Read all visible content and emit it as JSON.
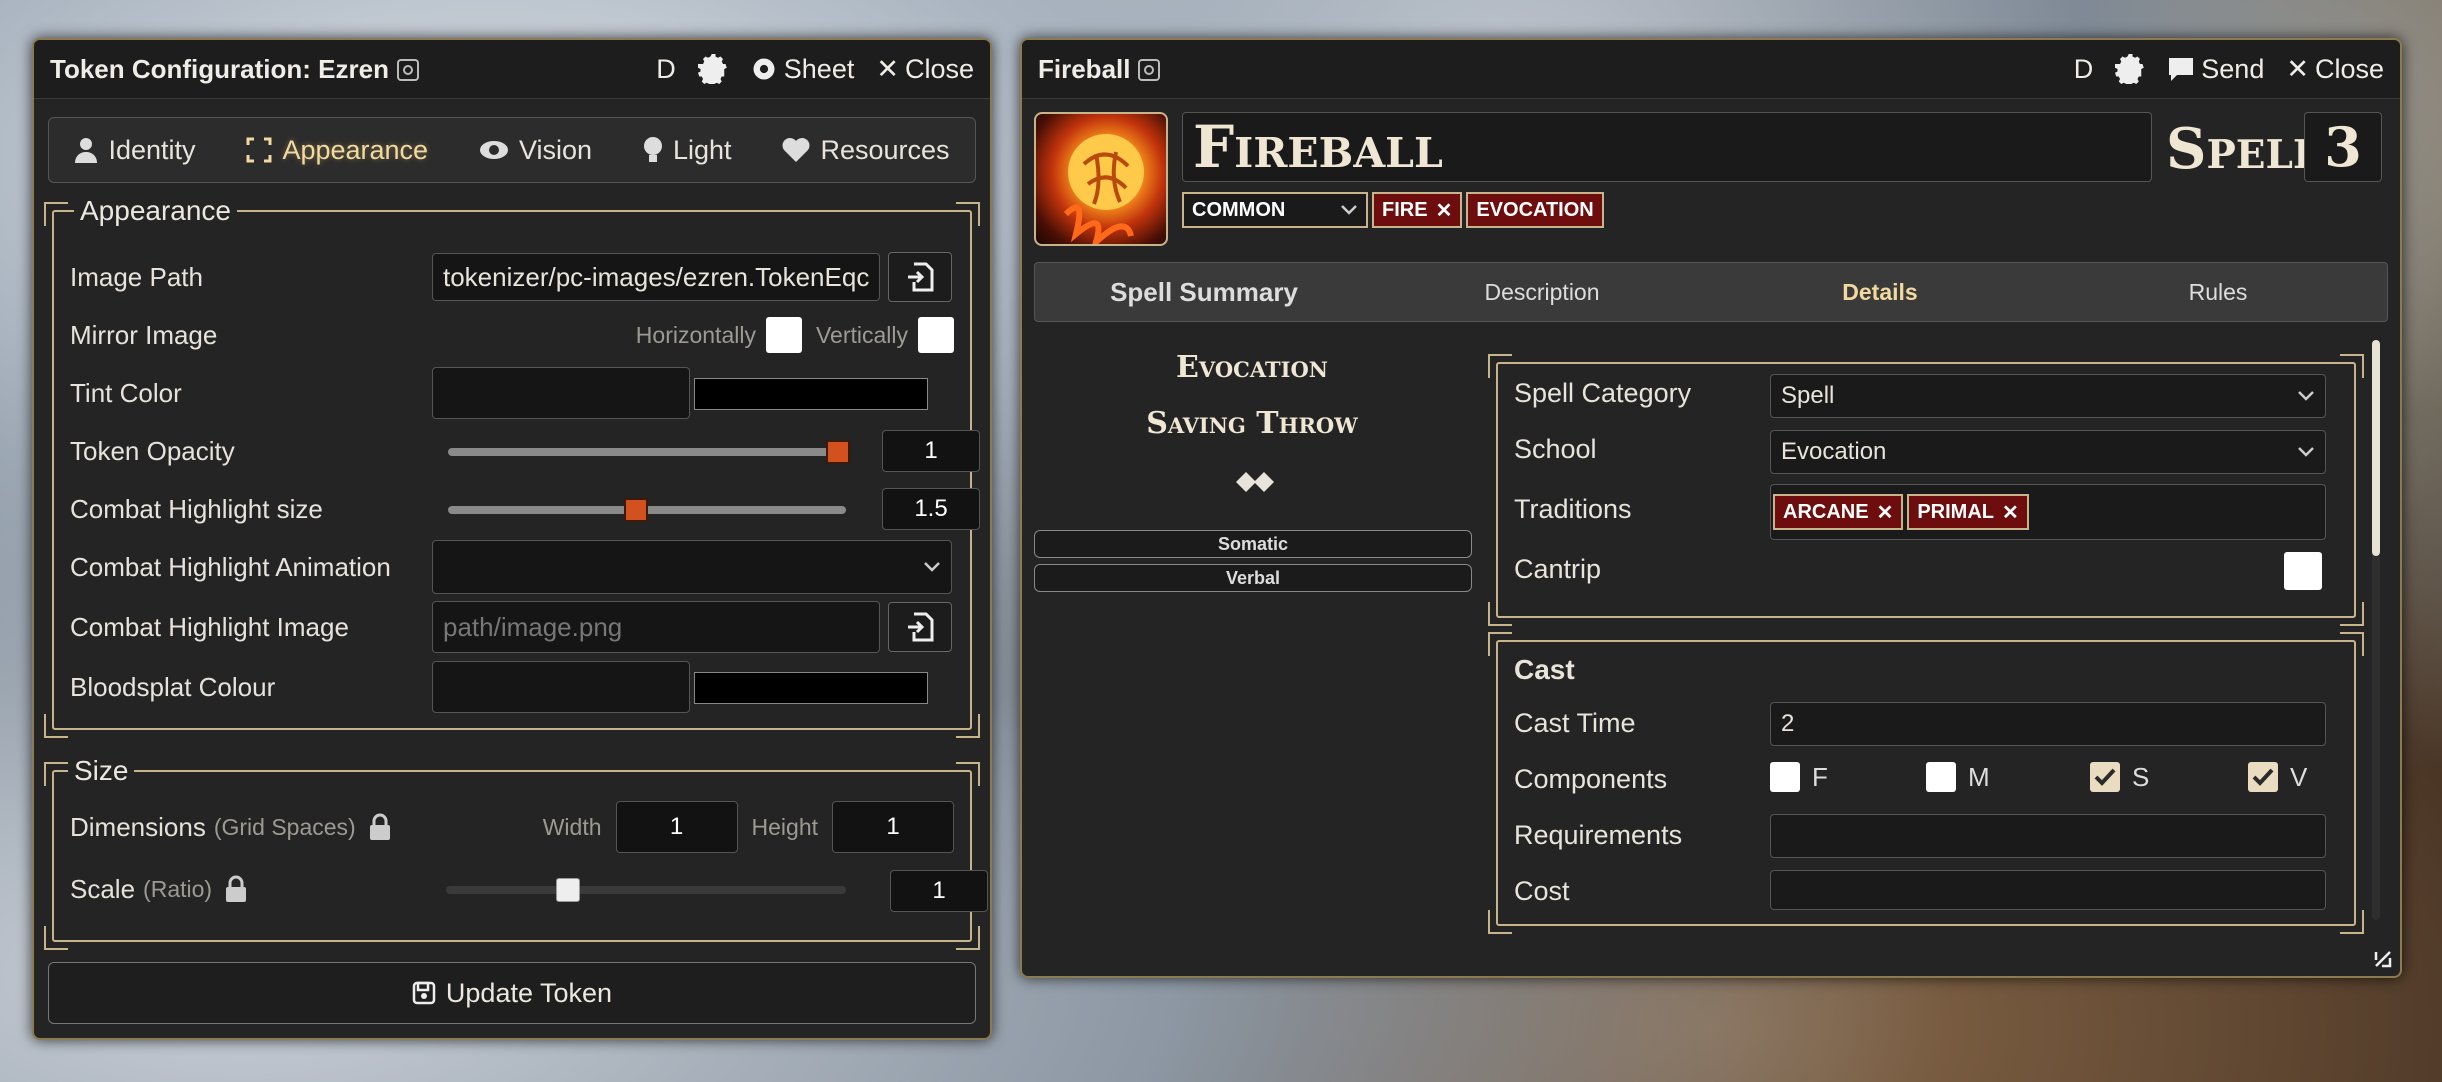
{
  "token_window": {
    "title": "Token Configuration: Ezren",
    "header_d": "D",
    "sheet_label": "Sheet",
    "close_label": "Close",
    "tabs": [
      {
        "label": "Identity",
        "icon": "person-icon"
      },
      {
        "label": "Appearance",
        "icon": "expand-icon"
      },
      {
        "label": "Vision",
        "icon": "eye-icon"
      },
      {
        "label": "Light",
        "icon": "lightbulb-icon"
      },
      {
        "label": "Resources",
        "icon": "heart-icon"
      }
    ],
    "appearance": {
      "legend": "Appearance",
      "image_path_label": "Image Path",
      "image_path_value": "tokenizer/pc-images/ezren.TokenEqc",
      "mirror_label": "Mirror Image",
      "horizontally": "Horizontally",
      "vertically": "Vertically",
      "tint_label": "Tint Color",
      "tint_swatch": "#000000",
      "opacity_label": "Token Opacity",
      "opacity_value": "1",
      "highlight_size_label": "Combat Highlight size",
      "highlight_size_value": "1.5",
      "highlight_anim_label": "Combat Highlight Animation",
      "highlight_image_label": "Combat Highlight Image",
      "highlight_image_placeholder": "path/image.png",
      "bloodsplat_label": "Bloodsplat Colour",
      "bloodsplat_swatch": "#000000"
    },
    "size": {
      "legend": "Size",
      "dimensions_label": "Dimensions",
      "dimensions_hint": "(Grid Spaces)",
      "width_label": "Width",
      "width_value": "1",
      "height_label": "Height",
      "height_value": "1",
      "scale_label": "Scale",
      "scale_hint": "(Ratio)",
      "scale_value": "1"
    },
    "update_label": "Update Token"
  },
  "spell_window": {
    "title": "Fireball",
    "header_d": "D",
    "send_label": "Send",
    "close_label": "Close",
    "name": "Fireball",
    "type_label": "Spell",
    "level": "3",
    "rarity": "COMMON",
    "traits": [
      "FIRE",
      "EVOCATION"
    ],
    "tabs": [
      "Spell Summary",
      "Description",
      "Details",
      "Rules"
    ],
    "summary": {
      "school": "Evocation",
      "save": "Saving Throw",
      "components": [
        "Somatic",
        "Verbal"
      ]
    },
    "details": {
      "category_label": "Spell Category",
      "category_value": "Spell",
      "school_label": "School",
      "school_value": "Evocation",
      "traditions_label": "Traditions",
      "traditions": [
        "ARCANE",
        "PRIMAL"
      ],
      "cantrip_label": "Cantrip"
    },
    "cast": {
      "legend": "Cast",
      "cast_time_label": "Cast Time",
      "cast_time_value": "2",
      "components_label": "Components",
      "components": [
        {
          "label": "F",
          "checked": false
        },
        {
          "label": "M",
          "checked": false
        },
        {
          "label": "S",
          "checked": true
        },
        {
          "label": "V",
          "checked": true
        }
      ],
      "requirements_label": "Requirements",
      "cost_label": "Cost"
    }
  },
  "colors": {
    "accent_gold": "#c8b48a",
    "tag_red": "#6e0d0d",
    "slider_thumb": "#d2511e"
  }
}
